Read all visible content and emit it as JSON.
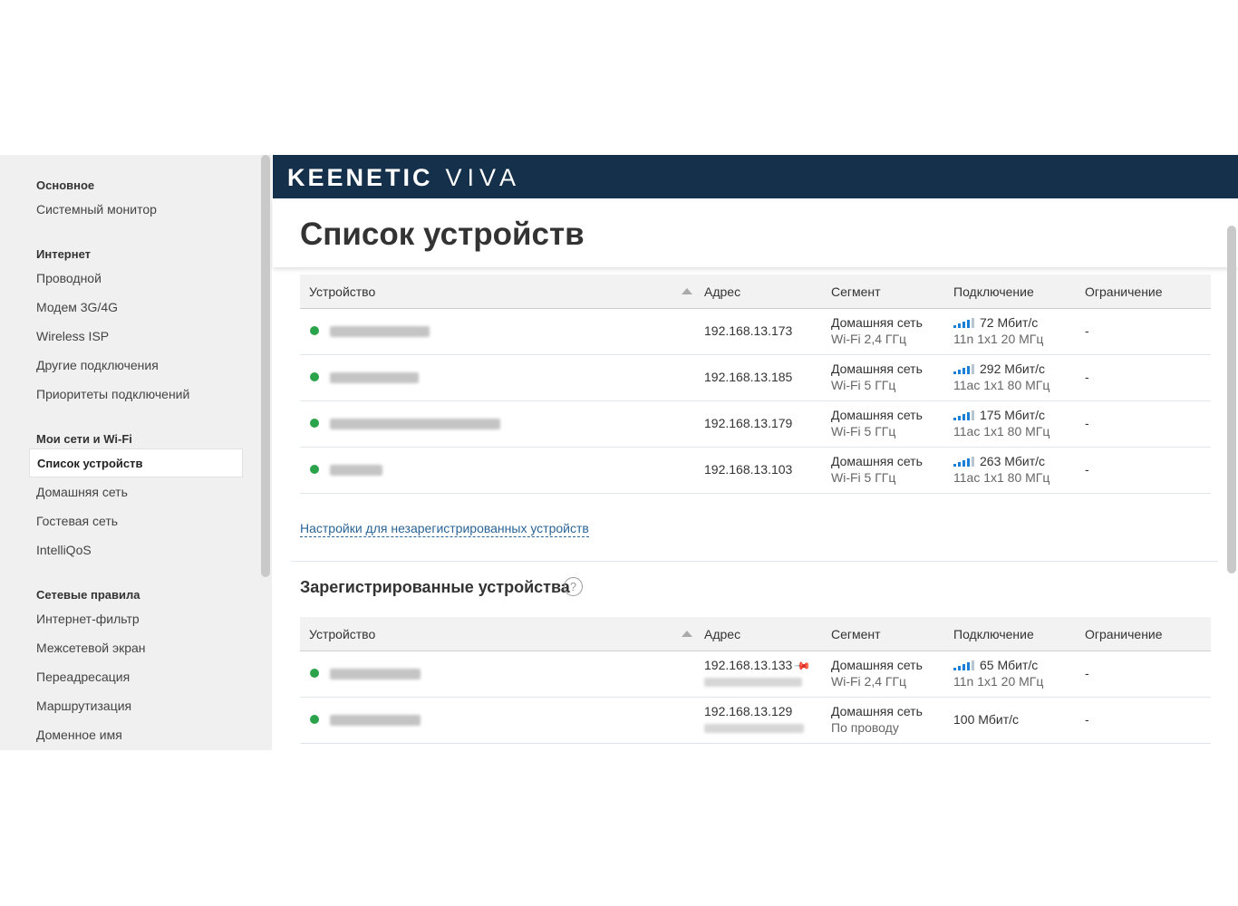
{
  "sidebar": {
    "sections": [
      {
        "title": "Основное",
        "items": [
          "Системный монитор"
        ]
      },
      {
        "title": "Интернет",
        "items": [
          "Проводной",
          "Модем 3G/4G",
          "Wireless ISP",
          "Другие подключения",
          "Приоритеты подключений"
        ]
      },
      {
        "title": "Мои сети и Wi-Fi",
        "items": [
          "Список устройств",
          "Домашняя сеть",
          "Гостевая сеть",
          "IntelliQoS"
        ]
      },
      {
        "title": "Сетевые правила",
        "items": [
          "Интернет-фильтр",
          "Межсетевой экран",
          "Переадресация",
          "Маршрутизация",
          "Доменное имя"
        ]
      }
    ],
    "active_item": "Список устройств"
  },
  "header": {
    "brand": "KEENETIC",
    "model": "VIVA"
  },
  "page": {
    "title": "Список устройств"
  },
  "columns": [
    "Устройство",
    "Адрес",
    "Сегмент",
    "Подключение",
    "Ограничение"
  ],
  "unregistered_devices": [
    {
      "ip": "192.168.13.173",
      "segment": "Домашняя сеть",
      "band": "Wi-Fi 2,4 ГГц",
      "speed": "72 Мбит/с",
      "mode": "11n 1x1 20 МГц",
      "limit": "-",
      "status_color": "#2ba34b"
    },
    {
      "ip": "192.168.13.185",
      "segment": "Домашняя сеть",
      "band": "Wi-Fi 5 ГГц",
      "speed": "292 Мбит/с",
      "mode": "11ac 1x1 80 МГц",
      "limit": "-",
      "status_color": "#2ba34b"
    },
    {
      "ip": "192.168.13.179",
      "segment": "Домашняя сеть",
      "band": "Wi-Fi 5 ГГц",
      "speed": "175 Мбит/с",
      "mode": "11ac 1x1 80 МГц",
      "limit": "-",
      "status_color": "#2ba34b"
    },
    {
      "ip": "192.168.13.103",
      "segment": "Домашняя сеть",
      "band": "Wi-Fi 5 ГГц",
      "speed": "263 Мбит/с",
      "mode": "11ac 1x1 80 МГц",
      "limit": "-",
      "status_color": "#2ba34b"
    }
  ],
  "unregistered_settings_link": "Настройки для незарегистрированных устройств",
  "registered_section": {
    "title": "Зарегистрированные устройства",
    "help_icon": "?"
  },
  "registered_devices": [
    {
      "ip": "192.168.13.133",
      "pinned": true,
      "segment": "Домашняя сеть",
      "band": "Wi-Fi 2,4 ГГц",
      "speed": "65 Мбит/с",
      "mode": "11n 1x1 20 МГц",
      "limit": "-",
      "status_color": "#2ba34b"
    },
    {
      "ip": "192.168.13.129",
      "pinned": false,
      "segment": "Домашняя сеть",
      "band": "По проводу",
      "speed": "100 Мбит/с",
      "mode": "",
      "limit": "-",
      "status_color": "#2ba34b"
    }
  ],
  "icons": {
    "status": "status-dot-icon",
    "signal": "wifi-signal-icon",
    "pin": "pin-icon",
    "help": "help-icon",
    "sort": "sort-ascending-icon"
  },
  "colors": {
    "header_bg": "#15304a",
    "status_online": "#2ba34b",
    "signal": "#1a7fd6",
    "link": "#2a6496"
  }
}
